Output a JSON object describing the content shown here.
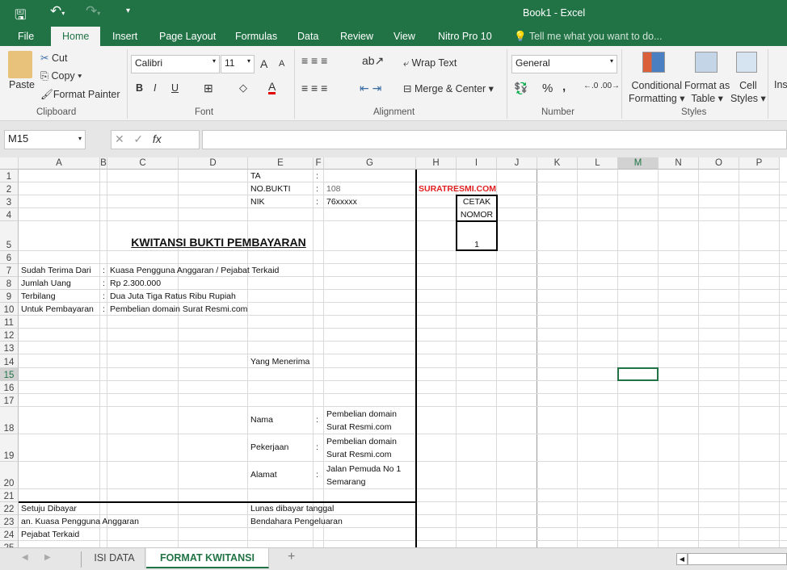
{
  "window": {
    "title": "Book1 - Excel"
  },
  "qat": {
    "save": "save-icon",
    "undo": "undo-icon",
    "redo": "redo-icon",
    "customize": "customize-icon"
  },
  "tabs": [
    "File",
    "Home",
    "Insert",
    "Page Layout",
    "Formulas",
    "Data",
    "Review",
    "View",
    "Nitro Pro 10"
  ],
  "tell_me": "Tell me what you want to do...",
  "clipboard": {
    "paste": "Paste",
    "cut": "Cut",
    "copy": "Copy",
    "format_painter": "Format Painter",
    "label": "Clipboard"
  },
  "font": {
    "name": "Calibri",
    "size": "11",
    "bold": "B",
    "italic": "I",
    "underline": "U",
    "label": "Font",
    "font_color": "#e00000"
  },
  "alignment": {
    "wrap": "Wrap Text",
    "merge": "Merge & Center",
    "label": "Alignment"
  },
  "number": {
    "format": "General",
    "percent": "%",
    "comma": ",",
    "label": "Number"
  },
  "styles": {
    "conditional": "Conditional",
    "conditional2": "Formatting",
    "format_as": "Format as",
    "table": "Table",
    "cell": "Cell",
    "styles": "Styles",
    "label": "Styles"
  },
  "cells_group": {
    "insert": "Ins"
  },
  "formula_bar": {
    "name_box": "M15",
    "fx": "fx",
    "value": ""
  },
  "columns": [
    "A",
    "B",
    "C",
    "D",
    "E",
    "F",
    "G",
    "H",
    "I",
    "J",
    "K",
    "L",
    "M",
    "N",
    "O",
    "P"
  ],
  "rows": [
    "1",
    "2",
    "3",
    "4",
    "5",
    "6",
    "7",
    "8",
    "9",
    "10",
    "11",
    "12",
    "13",
    "14",
    "15",
    "16",
    "17",
    "18",
    "19",
    "20",
    "21",
    "22",
    "23",
    "24",
    "25"
  ],
  "selected_cell": "M15",
  "accent": "#217346",
  "cells": [
    {
      "ref": "E1",
      "text": "TA"
    },
    {
      "ref": "F1",
      "text": ":"
    },
    {
      "ref": "E2",
      "text": "NO.BUKTI"
    },
    {
      "ref": "F2",
      "text": ":"
    },
    {
      "ref": "G2",
      "text": "108",
      "color": "#666"
    },
    {
      "ref": "H2",
      "text": "SURATRESMI.COM",
      "color": "#e02020",
      "bold": true
    },
    {
      "ref": "E3",
      "text": "NIK"
    },
    {
      "ref": "F3",
      "text": ":"
    },
    {
      "ref": "G3",
      "text": "76xxxxx"
    },
    {
      "ref": "I3",
      "text": "CETAK",
      "center": true
    },
    {
      "ref": "I4",
      "text": "NOMOR",
      "center": true
    },
    {
      "ref": "I5",
      "text": "1",
      "center": true
    },
    {
      "ref": "A5",
      "text": "KWITANSI BUKTI PEMBAYARAN",
      "title": true
    },
    {
      "ref": "A7",
      "text": "Sudah Terima Dari"
    },
    {
      "ref": "B7",
      "text": ":"
    },
    {
      "ref": "C7",
      "text": "Kuasa Pengguna Anggaran / Pejabat Terkaid"
    },
    {
      "ref": "A8",
      "text": "Jumlah Uang"
    },
    {
      "ref": "B8",
      "text": ":"
    },
    {
      "ref": "C8",
      "text": " Rp      2.300.000"
    },
    {
      "ref": "A9",
      "text": "Terbilang"
    },
    {
      "ref": "B9",
      "text": ":"
    },
    {
      "ref": "C9",
      "text": "Dua Juta Tiga Ratus Ribu Rupiah"
    },
    {
      "ref": "A10",
      "text": "Untuk Pembayaran"
    },
    {
      "ref": "B10",
      "text": ":"
    },
    {
      "ref": "C10",
      "text": "Pembelian domain Surat Resmi.com"
    },
    {
      "ref": "E14",
      "text": "Yang Menerima"
    },
    {
      "ref": "E18",
      "text": "Nama",
      "middle": true
    },
    {
      "ref": "F18",
      "text": ":",
      "middle": true
    },
    {
      "ref": "G18",
      "text": "Pembelian domain Surat Resmi.com",
      "wrap": true
    },
    {
      "ref": "E19",
      "text": "Pekerjaan",
      "middle": true
    },
    {
      "ref": "F19",
      "text": ":",
      "middle": true
    },
    {
      "ref": "G19",
      "text": "Pembelian domain Surat Resmi.com",
      "wrap": true
    },
    {
      "ref": "E20",
      "text": "Alamat",
      "middle": true
    },
    {
      "ref": "F20",
      "text": ":",
      "middle": true
    },
    {
      "ref": "G20",
      "text": "Jalan Pemuda No 1 Semarang",
      "wrap": true
    },
    {
      "ref": "A22",
      "text": "Setuju Dibayar"
    },
    {
      "ref": "E22",
      "text": "Lunas dibayar tanggal"
    },
    {
      "ref": "A23",
      "text": "an. Kuasa Pengguna Anggaran"
    },
    {
      "ref": "E23",
      "text": "Bendahara Pengeluaran"
    },
    {
      "ref": "A24",
      "text": "        Pejabat Terkaid"
    }
  ],
  "sheet_tabs": [
    {
      "label": "ISI DATA",
      "active": false
    },
    {
      "label": "FORMAT KWITANSI",
      "active": true
    }
  ],
  "add_sheet": "+"
}
